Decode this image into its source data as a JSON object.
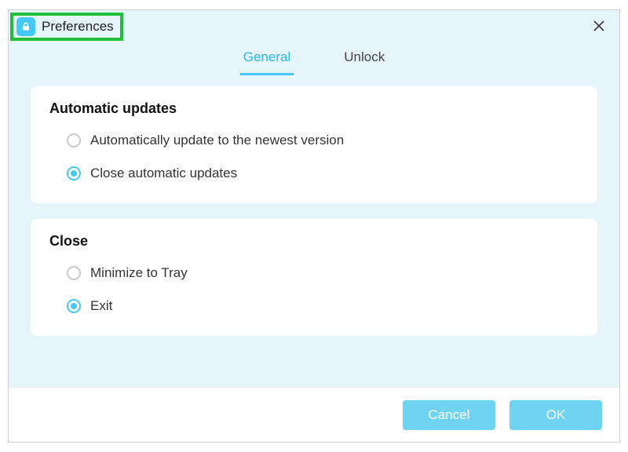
{
  "colors": {
    "accent": "#44c8f5",
    "highlight_border": "#22c03a"
  },
  "window": {
    "title": "Preferences"
  },
  "tabs": [
    {
      "id": "general",
      "label": "General",
      "active": true
    },
    {
      "id": "unlock",
      "label": "Unlock",
      "active": false
    }
  ],
  "sections": {
    "updates": {
      "title": "Automatic updates",
      "options": [
        {
          "id": "auto-on",
          "label": "Automatically update to the newest version",
          "selected": false
        },
        {
          "id": "auto-off",
          "label": "Close automatic updates",
          "selected": true
        }
      ]
    },
    "close": {
      "title": "Close",
      "options": [
        {
          "id": "min-tray",
          "label": "Minimize to Tray",
          "selected": false
        },
        {
          "id": "exit",
          "label": "Exit",
          "selected": true
        }
      ]
    }
  },
  "footer": {
    "cancel": "Cancel",
    "ok": "OK"
  }
}
